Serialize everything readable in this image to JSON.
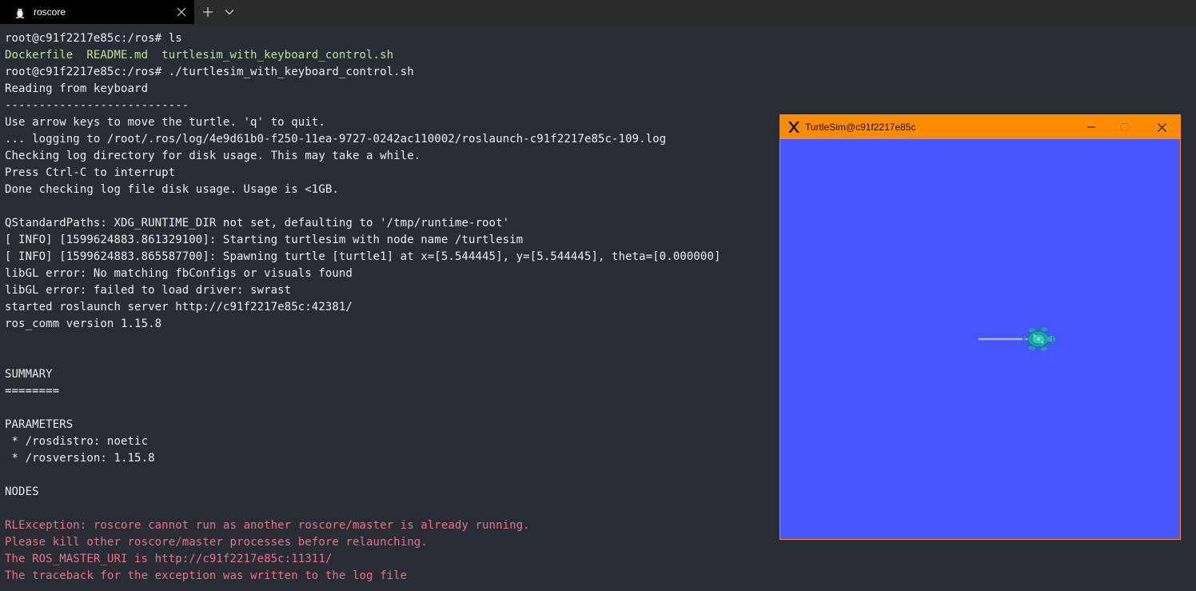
{
  "tab": {
    "title": "roscore",
    "icon": "linux-penguin-icon"
  },
  "tabbar": {
    "new_tab_icon": "plus-icon",
    "dropdown_icon": "chevron-down-icon",
    "close_icon": "close-icon"
  },
  "terminal": {
    "lines": [
      {
        "parts": [
          {
            "text": "root@c91f2217e85c:/ros# ls",
            "style": "normal"
          }
        ]
      },
      {
        "parts": [
          {
            "text": "Dockerfile  README.md  turtlesim_with_keyboard_control.sh",
            "style": "green"
          }
        ]
      },
      {
        "parts": [
          {
            "text": "root@c91f2217e85c:/ros# ./turtlesim_with_keyboard_control.sh",
            "style": "normal"
          }
        ]
      },
      {
        "parts": [
          {
            "text": "Reading from keyboard",
            "style": "normal"
          }
        ]
      },
      {
        "parts": [
          {
            "text": "---------------------------",
            "style": "normal"
          }
        ]
      },
      {
        "parts": [
          {
            "text": "Use arrow keys to move the turtle. 'q' to quit.",
            "style": "normal"
          }
        ]
      },
      {
        "parts": [
          {
            "text": "... logging to /root/.ros/log/4e9d61b0-f250-11ea-9727-0242ac110002/roslaunch-c91f2217e85c-109.log",
            "style": "normal"
          }
        ]
      },
      {
        "parts": [
          {
            "text": "Checking log directory for disk usage. This may take a while.",
            "style": "normal"
          }
        ]
      },
      {
        "parts": [
          {
            "text": "Press Ctrl-C to interrupt",
            "style": "normal"
          }
        ]
      },
      {
        "parts": [
          {
            "text": "Done checking log file disk usage. Usage is <1GB.",
            "style": "normal"
          }
        ]
      },
      {
        "parts": [
          {
            "text": "",
            "style": "normal"
          }
        ]
      },
      {
        "parts": [
          {
            "text": "QStandardPaths: XDG_RUNTIME_DIR not set, defaulting to '/tmp/runtime-root'",
            "style": "normal"
          }
        ]
      },
      {
        "parts": [
          {
            "text": "[ INFO] [1599624883.861329100]: Starting turtlesim with node name /turtlesim",
            "style": "normal"
          }
        ]
      },
      {
        "parts": [
          {
            "text": "[ INFO] [1599624883.865587700]: Spawning turtle [turtle1] at x=[5.544445], y=[5.544445], theta=[0.000000]",
            "style": "normal"
          }
        ]
      },
      {
        "parts": [
          {
            "text": "libGL error: No matching fbConfigs or visuals found",
            "style": "normal"
          }
        ]
      },
      {
        "parts": [
          {
            "text": "libGL error: failed to load driver: swrast",
            "style": "normal"
          }
        ]
      },
      {
        "parts": [
          {
            "text": "started roslaunch server http://c91f2217e85c:42381/",
            "style": "normal"
          }
        ]
      },
      {
        "parts": [
          {
            "text": "ros_comm version 1.15.8",
            "style": "normal"
          }
        ]
      },
      {
        "parts": [
          {
            "text": "",
            "style": "normal"
          }
        ]
      },
      {
        "parts": [
          {
            "text": "",
            "style": "normal"
          }
        ]
      },
      {
        "parts": [
          {
            "text": "SUMMARY",
            "style": "normal"
          }
        ]
      },
      {
        "parts": [
          {
            "text": "========",
            "style": "normal"
          }
        ]
      },
      {
        "parts": [
          {
            "text": "",
            "style": "normal"
          }
        ]
      },
      {
        "parts": [
          {
            "text": "PARAMETERS",
            "style": "normal"
          }
        ]
      },
      {
        "parts": [
          {
            "text": " * /rosdistro: noetic",
            "style": "normal"
          }
        ]
      },
      {
        "parts": [
          {
            "text": " * /rosversion: 1.15.8",
            "style": "normal"
          }
        ]
      },
      {
        "parts": [
          {
            "text": "",
            "style": "normal"
          }
        ]
      },
      {
        "parts": [
          {
            "text": "NODES",
            "style": "normal"
          }
        ]
      },
      {
        "parts": [
          {
            "text": "",
            "style": "normal"
          }
        ]
      },
      {
        "parts": [
          {
            "text": "RLException: roscore cannot run as another roscore/master is already running.",
            "style": "error"
          }
        ]
      },
      {
        "parts": [
          {
            "text": "Please kill other roscore/master processes before relaunching.",
            "style": "error"
          }
        ]
      },
      {
        "parts": [
          {
            "text": "The ROS_MASTER_URI is http://c91f2217e85c:11311/",
            "style": "error"
          }
        ]
      },
      {
        "parts": [
          {
            "text": "The traceback for the exception was written to the log file",
            "style": "error"
          }
        ]
      }
    ]
  },
  "turtlesim": {
    "title": "TurtleSim@c91f2217e85c",
    "app_icon": "x-logo-icon",
    "minimize_icon": "minimize-icon",
    "maximize_icon": "maximize-icon",
    "close_icon": "close-icon",
    "colors": {
      "titlebar": "#ff8c00",
      "background": "#4556ff",
      "trail": "#b3b8ff"
    }
  }
}
